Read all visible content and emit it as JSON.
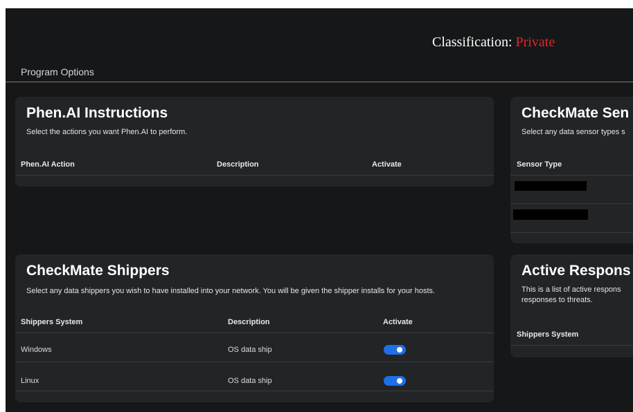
{
  "classification": {
    "label": "Classification:",
    "value": "Private"
  },
  "program_options": "Program Options",
  "phen_card": {
    "title": "Phen.AI Instructions",
    "description": "Select the actions you want Phen.AI to perform.",
    "columns": [
      "Phen.AI Action",
      "Description",
      "Activate"
    ]
  },
  "sensors_card": {
    "title": "CheckMate Sen",
    "description": "Select any data sensor types s",
    "columns": [
      "Sensor Type"
    ]
  },
  "shippers_card": {
    "title": "CheckMate Shippers",
    "description": "Select any data shippers you wish to have installed into your network. You will be given the shipper installs for your hosts.",
    "columns": [
      "Shippers System",
      "Description",
      "Activate"
    ],
    "rows": [
      {
        "system": "Windows",
        "description": "OS data ship",
        "active": true
      },
      {
        "system": "Linux",
        "description": "OS data ship",
        "active": true
      }
    ]
  },
  "active_card": {
    "title": "Active Respons",
    "description": "This is a list of active respons responses to threats.",
    "columns": [
      "Shippers System"
    ]
  },
  "colors": {
    "accent": "#1f6fe8",
    "classification_value": "#e0262b",
    "card_bg": "#222426",
    "page_bg": "#161718"
  }
}
